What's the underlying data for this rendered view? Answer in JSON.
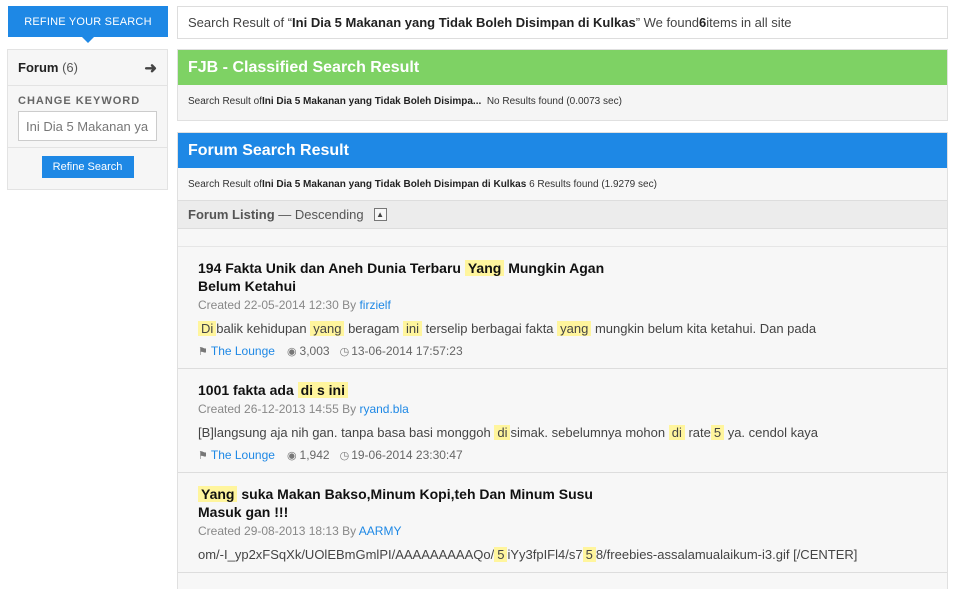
{
  "refine_tab": {
    "label": "REFINE YOUR SEARCH"
  },
  "summary": {
    "prefix": "Search Result of “",
    "query": "Ini Dia 5 Makanan yang Tidak Boleh Disimpan di Kulkas",
    "middle": "” We found ",
    "count": "6",
    "suffix": " items in all site"
  },
  "sidebar": {
    "forum_label": "Forum",
    "forum_count": "(6)",
    "change_keyword_label": "CHANGE KEYWORD",
    "keyword_value": "Ini Dia 5 Makanan ya",
    "refine_button": "Refine Search"
  },
  "fjb": {
    "title": "FJB - Classified Search Result",
    "prefix": "Search Result of ",
    "query": "Ini Dia 5 Makanan yang Tidak Boleh Disimpa...",
    "status": "No Results found (0.0073 sec)"
  },
  "forum": {
    "title": "Forum Search Result",
    "prefix": "Search Result of ",
    "query": "Ini Dia 5 Makanan yang Tidak Boleh Disimpan di Kulkas",
    "status": "6 Results found (1.9279 sec)",
    "listing_label": "Forum Listing",
    "listing_order": "— Descending",
    "items": [
      {
        "title_a": "194 Fakta Unik dan Aneh Dunia Terbaru ",
        "title_hl": "Yang",
        "title_b": " Mungkin Agan Belum Ketahui",
        "created": "Created 22-05-2014 12:30 By ",
        "author": "firzielf",
        "snippet": [
          {
            "t": "Di",
            "h": true
          },
          {
            "t": "balik kehidupan ",
            "h": false
          },
          {
            "t": "yang",
            "h": true
          },
          {
            "t": " beragam ",
            "h": false
          },
          {
            "t": "ini",
            "h": true
          },
          {
            "t": " terselip berbagai fakta ",
            "h": false
          },
          {
            "t": "yang",
            "h": true
          },
          {
            "t": " mungkin belum kita ketahui. Dan pada",
            "h": false
          }
        ],
        "tag": "The Lounge",
        "views": "3,003",
        "date": "13-06-2014 17:57:23"
      },
      {
        "title_a": "1001 fakta ada ",
        "title_hl": "di s ini",
        "title_b": "",
        "created": "Created 26-12-2013 14:55 By ",
        "author": "ryand.bla",
        "snippet": [
          {
            "t": "[B]langsung aja nih gan. tanpa basa basi monggoh ",
            "h": false
          },
          {
            "t": "di",
            "h": true
          },
          {
            "t": "simak. sebelumnya mohon ",
            "h": false
          },
          {
            "t": "di",
            "h": true
          },
          {
            "t": " rate",
            "h": false
          },
          {
            "t": "5",
            "h": true
          },
          {
            "t": " ya. cendol kaya",
            "h": false
          }
        ],
        "tag": "The Lounge",
        "views": "1,942",
        "date": "19-06-2014 23:30:47"
      },
      {
        "title_a": "",
        "title_hl": "Yang",
        "title_b": " suka Makan Bakso,Minum Kopi,teh Dan Minum Susu Masuk gan !!!",
        "created": "Created 29-08-2013 18:13 By ",
        "author": "AARMY",
        "snippet": [
          {
            "t": "om/-I_yp2xFSqXk/UOlEBmGmlPI/AAAAAAAAAQo/",
            "h": false
          },
          {
            "t": "5",
            "h": true
          },
          {
            "t": "iYy3fpIFl4/s7",
            "h": false
          },
          {
            "t": "5",
            "h": true
          },
          {
            "t": "8/freebies-assalamualaikum-i3.gif [/CENTER]",
            "h": false
          }
        ],
        "tag": "",
        "views": "",
        "date": ""
      }
    ]
  },
  "colors": {
    "accent_blue": "#1e88e5",
    "fjb_green": "#7ed264",
    "highlight": "#fff59d"
  },
  "icons": [
    "arrow-right-icon",
    "sort-toggle-icon",
    "tag-icon",
    "eye-icon",
    "clock-icon"
  ]
}
